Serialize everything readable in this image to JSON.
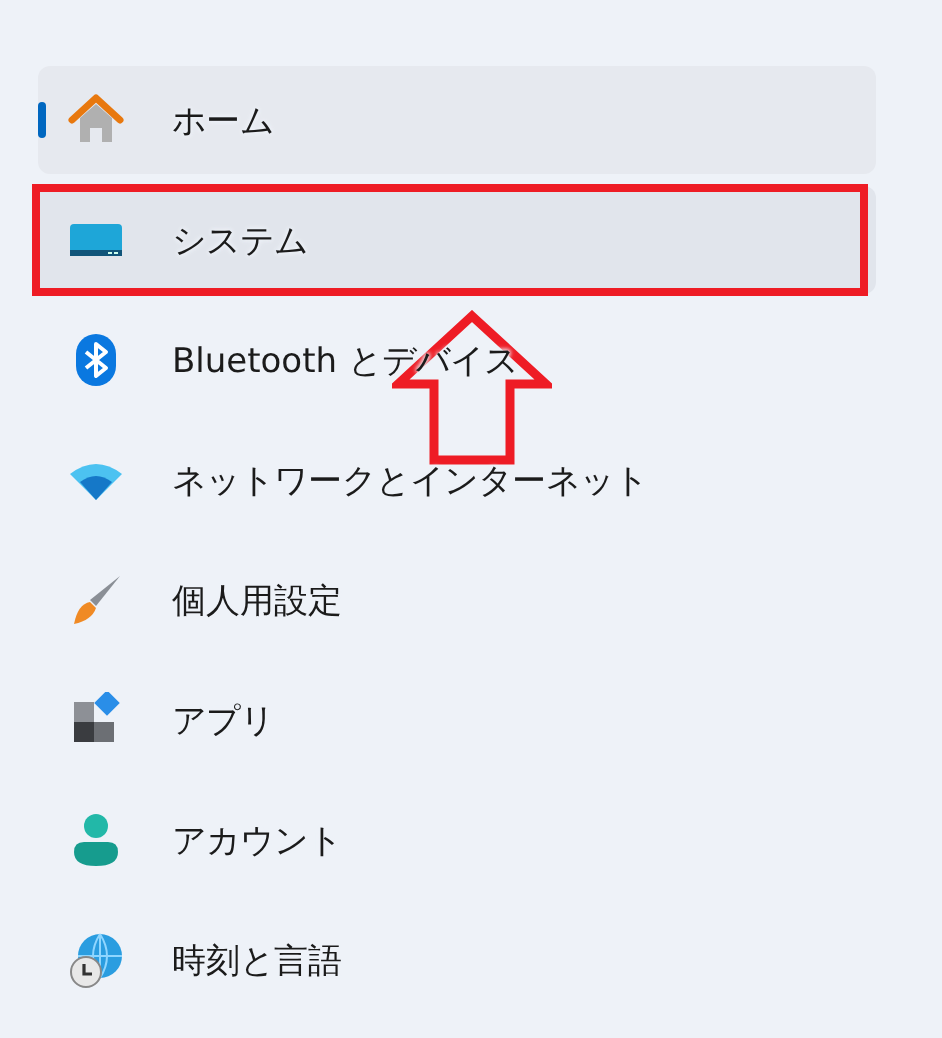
{
  "nav_items": [
    {
      "label": "ホーム",
      "selected": true,
      "highlighted": false,
      "marked": false
    },
    {
      "label": "システム",
      "selected": false,
      "highlighted": true,
      "marked": true
    },
    {
      "label": "Bluetooth とデバイス",
      "selected": false,
      "highlighted": false,
      "marked": false
    },
    {
      "label": "ネットワークとインターネット",
      "selected": false,
      "highlighted": false,
      "marked": false
    },
    {
      "label": "個人用設定",
      "selected": false,
      "highlighted": false,
      "marked": false
    },
    {
      "label": "アプリ",
      "selected": false,
      "highlighted": false,
      "marked": false
    },
    {
      "label": "アカウント",
      "selected": false,
      "highlighted": false,
      "marked": false
    },
    {
      "label": "時刻と言語",
      "selected": false,
      "highlighted": false,
      "marked": false
    }
  ],
  "annotations": [
    {
      "kind": "up-arrow"
    }
  ]
}
